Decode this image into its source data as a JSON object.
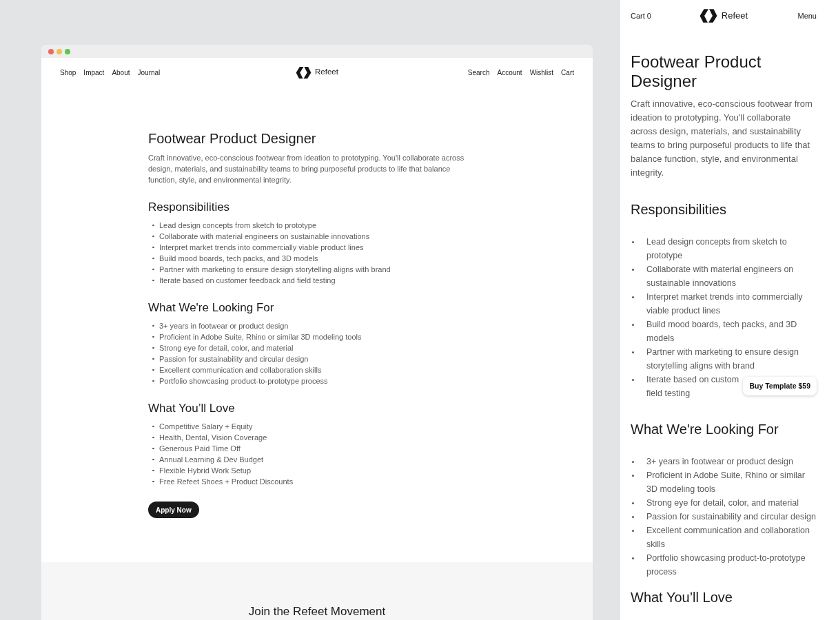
{
  "desktop": {
    "window_controls": [
      {
        "color": "#ed6a5e"
      },
      {
        "color": "#f5bf4f"
      },
      {
        "color": "#61c554"
      }
    ],
    "nav_left": [
      "Shop",
      "Impact",
      "About",
      "Journal"
    ],
    "brand": "Refeet",
    "nav_right": [
      "Search",
      "Account",
      "Wishlist",
      "Cart"
    ],
    "title": "Footwear Product Designer",
    "intro": "Craft innovative, eco-conscious footwear from ideation to prototyping. You'll collaborate across design, materials, and sustainability teams to bring purposeful products to life that balance function, style, and environmental integrity.",
    "sections": [
      {
        "heading": "Responsibilities",
        "items": [
          "Lead design concepts from sketch to prototype",
          "Collaborate with material engineers on sustainable innovations",
          "Interpret market trends into commercially viable product lines",
          "Build mood boards, tech packs, and 3D models",
          "Partner with marketing to ensure design storytelling aligns with brand",
          "Iterate based on customer feedback and field testing"
        ]
      },
      {
        "heading": "What We're Looking For",
        "items": [
          "3+ years in footwear or product design",
          "Proficient in Adobe Suite, Rhino or similar 3D modeling tools",
          "Strong eye for detail, color, and material",
          "Passion for sustainability and circular design",
          "Excellent communication and collaboration skills",
          "Portfolio showcasing product-to-prototype process"
        ]
      },
      {
        "heading": "What You’ll Love",
        "items": [
          "Competitive Salary + Equity",
          "Health, Dental, Vision Coverage",
          "Generous Paid Time Off",
          "Annual Learning & Dev Budget",
          "Flexible Hybrid Work Setup",
          "Free Refeet Shoes + Product Discounts"
        ]
      }
    ],
    "apply_button": "Apply Now",
    "footer_heading": "Join the Refeet Movement"
  },
  "mobile": {
    "cart": "Cart 0",
    "brand": "Refeet",
    "menu": "Menu",
    "title": "Footwear Product Designer",
    "intro": "Craft innovative, eco-conscious footwear from ideation to prototyping. You'll collaborate across design, materials, and sustainability teams to bring purposeful products to life that balance function, style, and environmental integrity.",
    "sections": [
      {
        "heading": "Responsibilities",
        "items": [
          "Lead design concepts from sketch to prototype",
          "Collaborate with material engineers on sustainable innovations",
          "Interpret market trends into commercially viable product lines",
          "Build mood boards, tech packs, and 3D models",
          "Partner with marketing to ensure design storytelling aligns with brand",
          "Iterate based on custom\nfield testing"
        ]
      },
      {
        "heading": "What We're Looking For",
        "items": [
          "3+ years in footwear or product design",
          "Proficient in Adobe Suite, Rhino or similar 3D modeling tools",
          "Strong eye for detail, color, and material",
          "Passion for sustainability and circular design",
          "Excellent communication and collaboration skills",
          "Portfolio showcasing product-to-prototype process"
        ]
      },
      {
        "heading": "What You’ll Love"
      }
    ],
    "buy_button": "Buy Template $59"
  }
}
